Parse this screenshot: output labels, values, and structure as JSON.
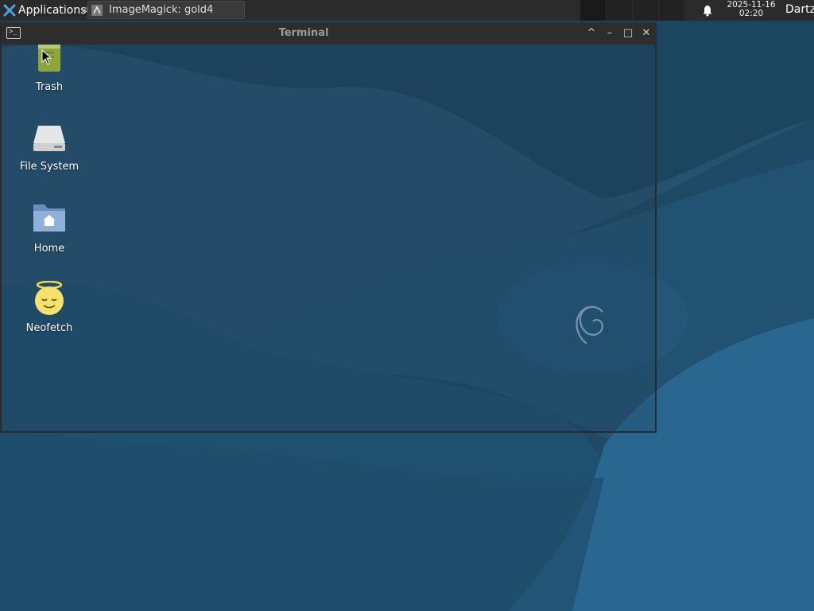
{
  "panel": {
    "applications_label": "Applications",
    "separator": "≡",
    "task_label": "ImageMagick: gold4",
    "clock_date": "2025-11-16",
    "clock_time": "02:20",
    "user": "Dartz",
    "icons": {
      "menu": "xfce-logo-icon",
      "task": "imagemagick-icon",
      "bell": "bell-icon"
    }
  },
  "terminal": {
    "title": "Terminal",
    "buttons": {
      "shade": "^",
      "minimize": "–",
      "maximize": "□",
      "close": "✕"
    }
  },
  "desktop": {
    "icons": [
      {
        "label": "Trash",
        "icon": "trash-icon"
      },
      {
        "label": "File System",
        "icon": "drive-icon"
      },
      {
        "label": "Home",
        "icon": "home-folder-icon"
      },
      {
        "label": "Neofetch",
        "icon": "angel-smiley-icon"
      }
    ]
  },
  "colors": {
    "wallpaper_dark": "#1e4560",
    "wallpaper_mid": "#25577a",
    "wallpaper_light": "#2a6a92",
    "panel_bg": "#2b2b2b",
    "titlebar_bg": "#2d2d2d"
  }
}
